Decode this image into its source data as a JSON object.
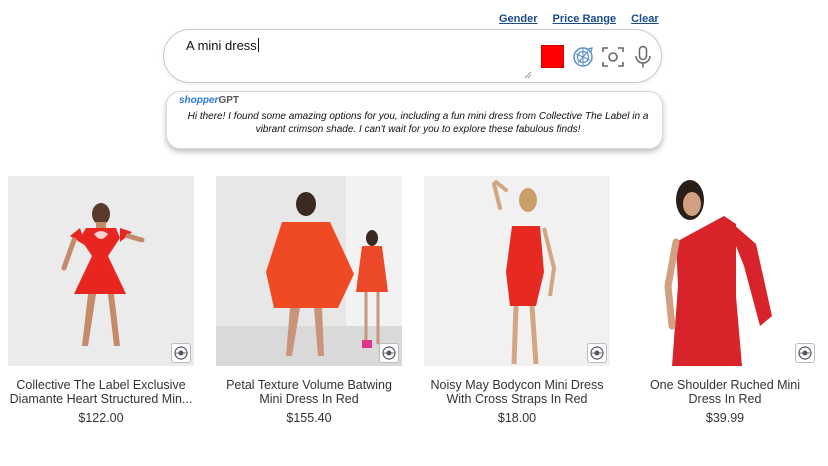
{
  "filters": {
    "gender": "Gender",
    "price_range": "Price Range",
    "clear": "Clear"
  },
  "search": {
    "value": "A mini dress",
    "color_swatch": "#ff0000",
    "icons": [
      "color-swatch",
      "pattern-icon",
      "camera-scan-icon",
      "microphone-icon"
    ]
  },
  "assistant": {
    "brand_part1": "shopper",
    "brand_part2": "GPT",
    "message": "Hi there! I found some amazing options for you, including a fun mini dress from Collective The Label in a vibrant crimson shade. I can't wait for you to explore these fabulous finds!"
  },
  "products": [
    {
      "title": "Collective The Label Exclusive Diamante Heart Structured Min...",
      "price": "$122.00",
      "color": "#e8251f"
    },
    {
      "title": "Petal Texture Volume Batwing Mini Dress In Red",
      "price": "$155.40",
      "color": "#f04a24"
    },
    {
      "title": "Noisy May Bodycon Mini Dress With Cross Straps In Red",
      "price": "$18.00",
      "color": "#e62a22"
    },
    {
      "title": "One Shoulder Ruched Mini Dress In Red",
      "price": "$39.99",
      "color": "#d9232a"
    }
  ]
}
